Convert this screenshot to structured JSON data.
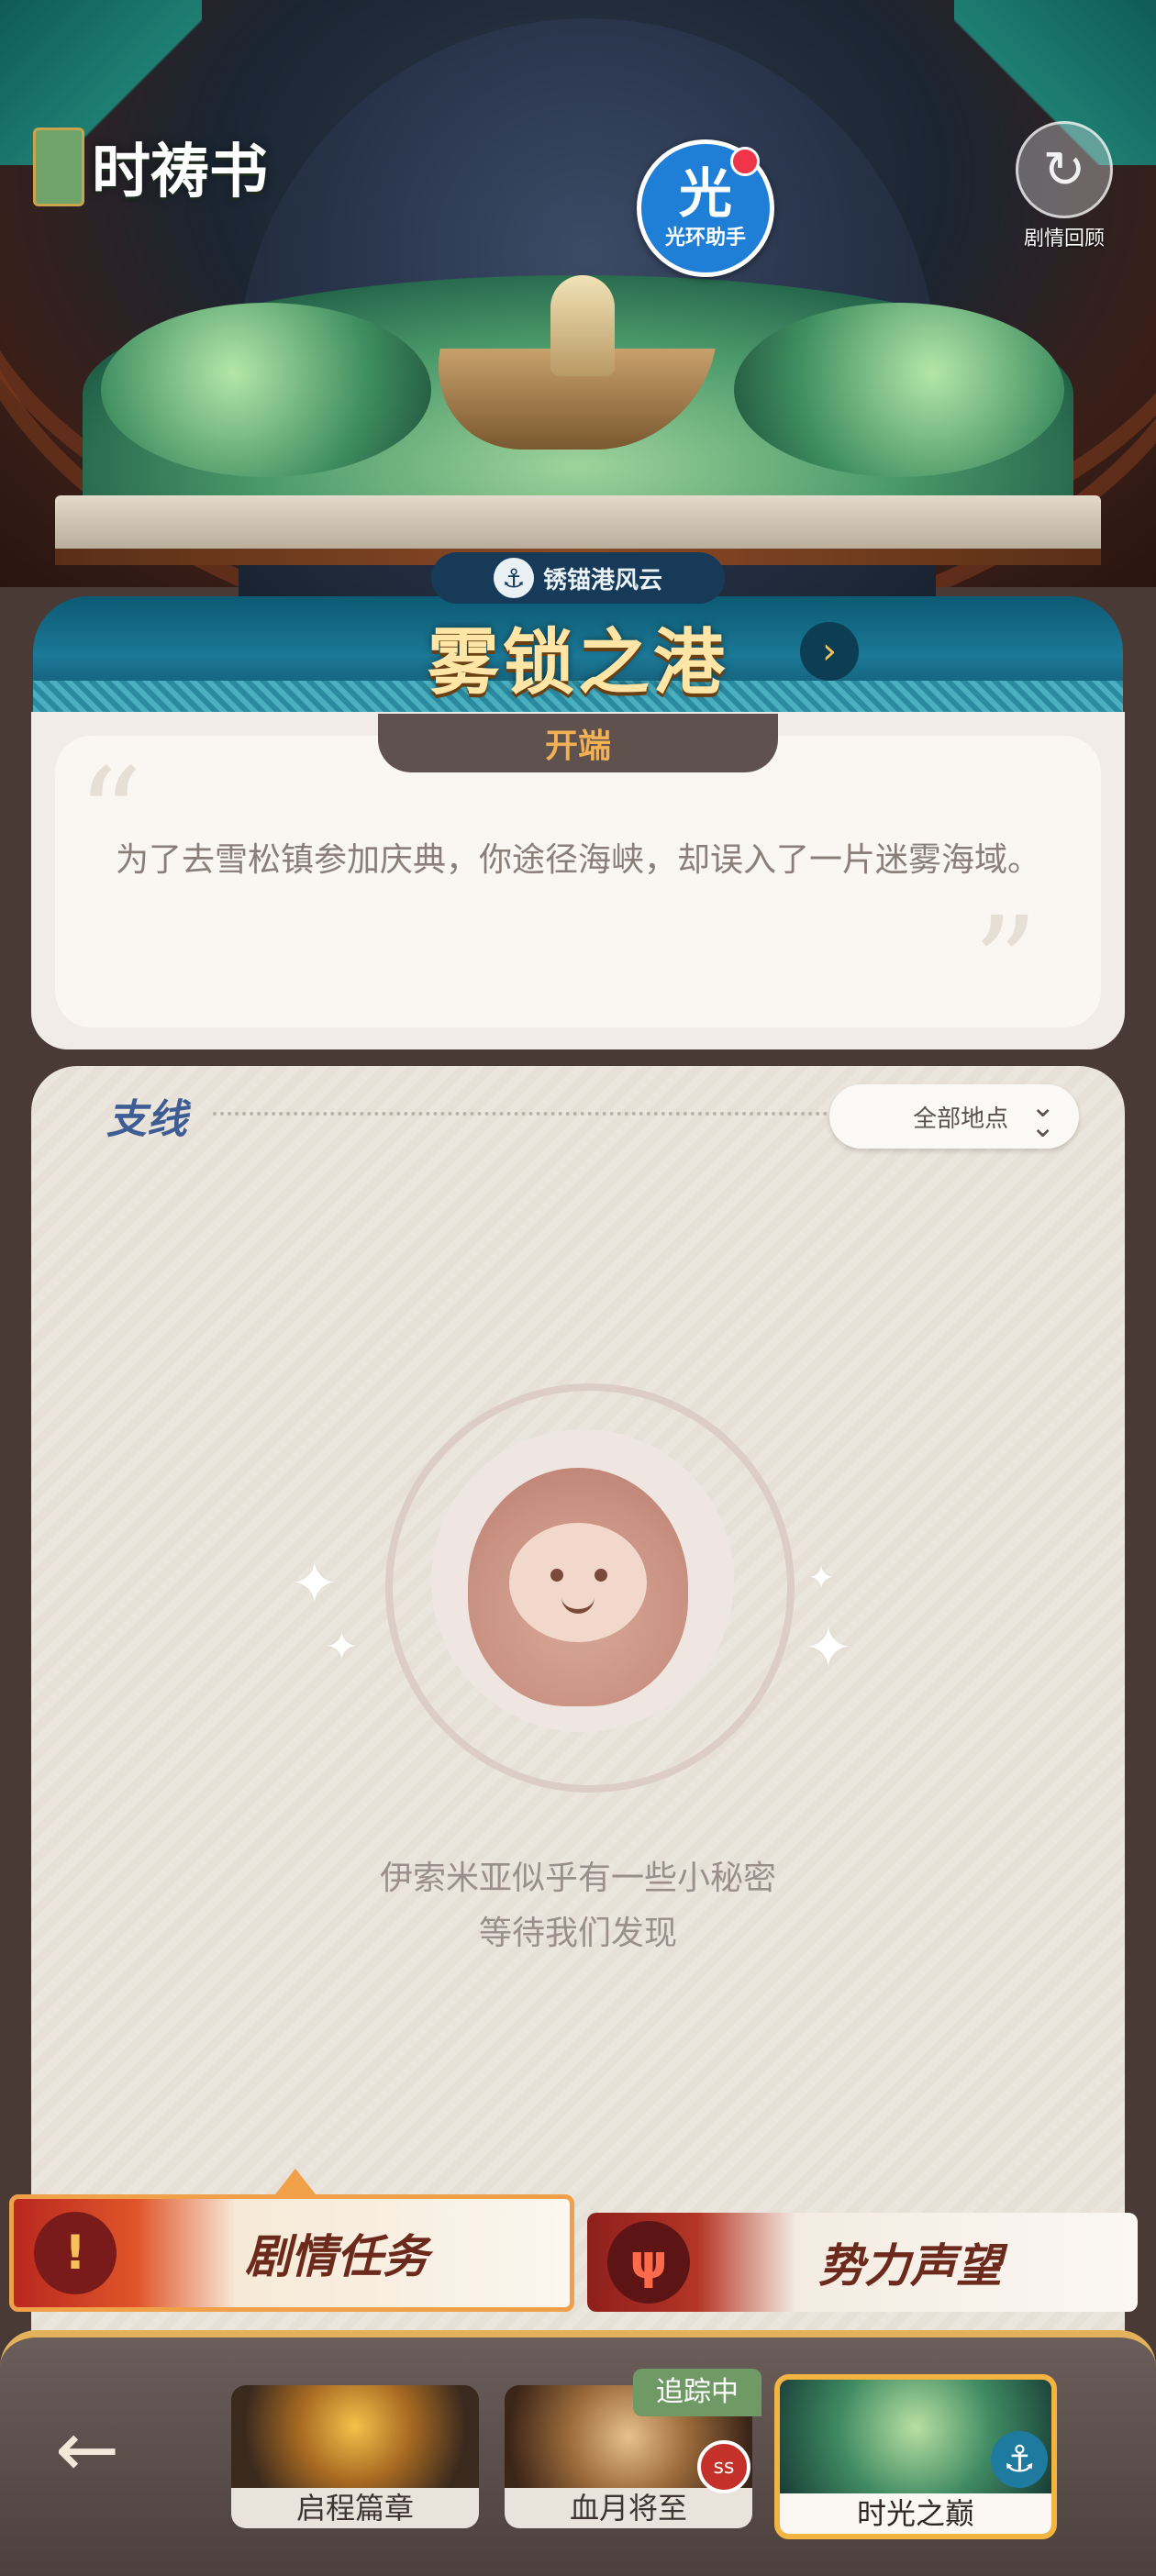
{
  "header": {
    "app_title": "时祷书",
    "assistant_label_big": "光",
    "assistant_label_small": "光环助手",
    "replay_label": "剧情回顾"
  },
  "chapter": {
    "tag": "锈锚港风云",
    "title": "雾锁之港",
    "stage": "开端",
    "description": "为了去雪松镇参加庆典，你途径海峡，却误入了一片迷雾海域。"
  },
  "side_quests": {
    "title": "支线",
    "filter_label": "全部地点",
    "empty_line1": "伊索米亚似乎有一些小秘密",
    "empty_line2": "等待我们发现"
  },
  "category_tabs": [
    {
      "label": "剧情任务",
      "active": true
    },
    {
      "label": "势力声望",
      "active": false
    }
  ],
  "bottom_nav": {
    "back_glyph": "←",
    "tracking_badge": "追踪中",
    "cards": [
      {
        "label": "启程篇章"
      },
      {
        "label": "血月将至"
      },
      {
        "label": "时光之巅"
      }
    ]
  },
  "colors": {
    "accent_gold": "#f1b154",
    "banner_teal": "#1b7896",
    "panel_bg": "#ebe6dd",
    "active_border": "#f4b441"
  }
}
